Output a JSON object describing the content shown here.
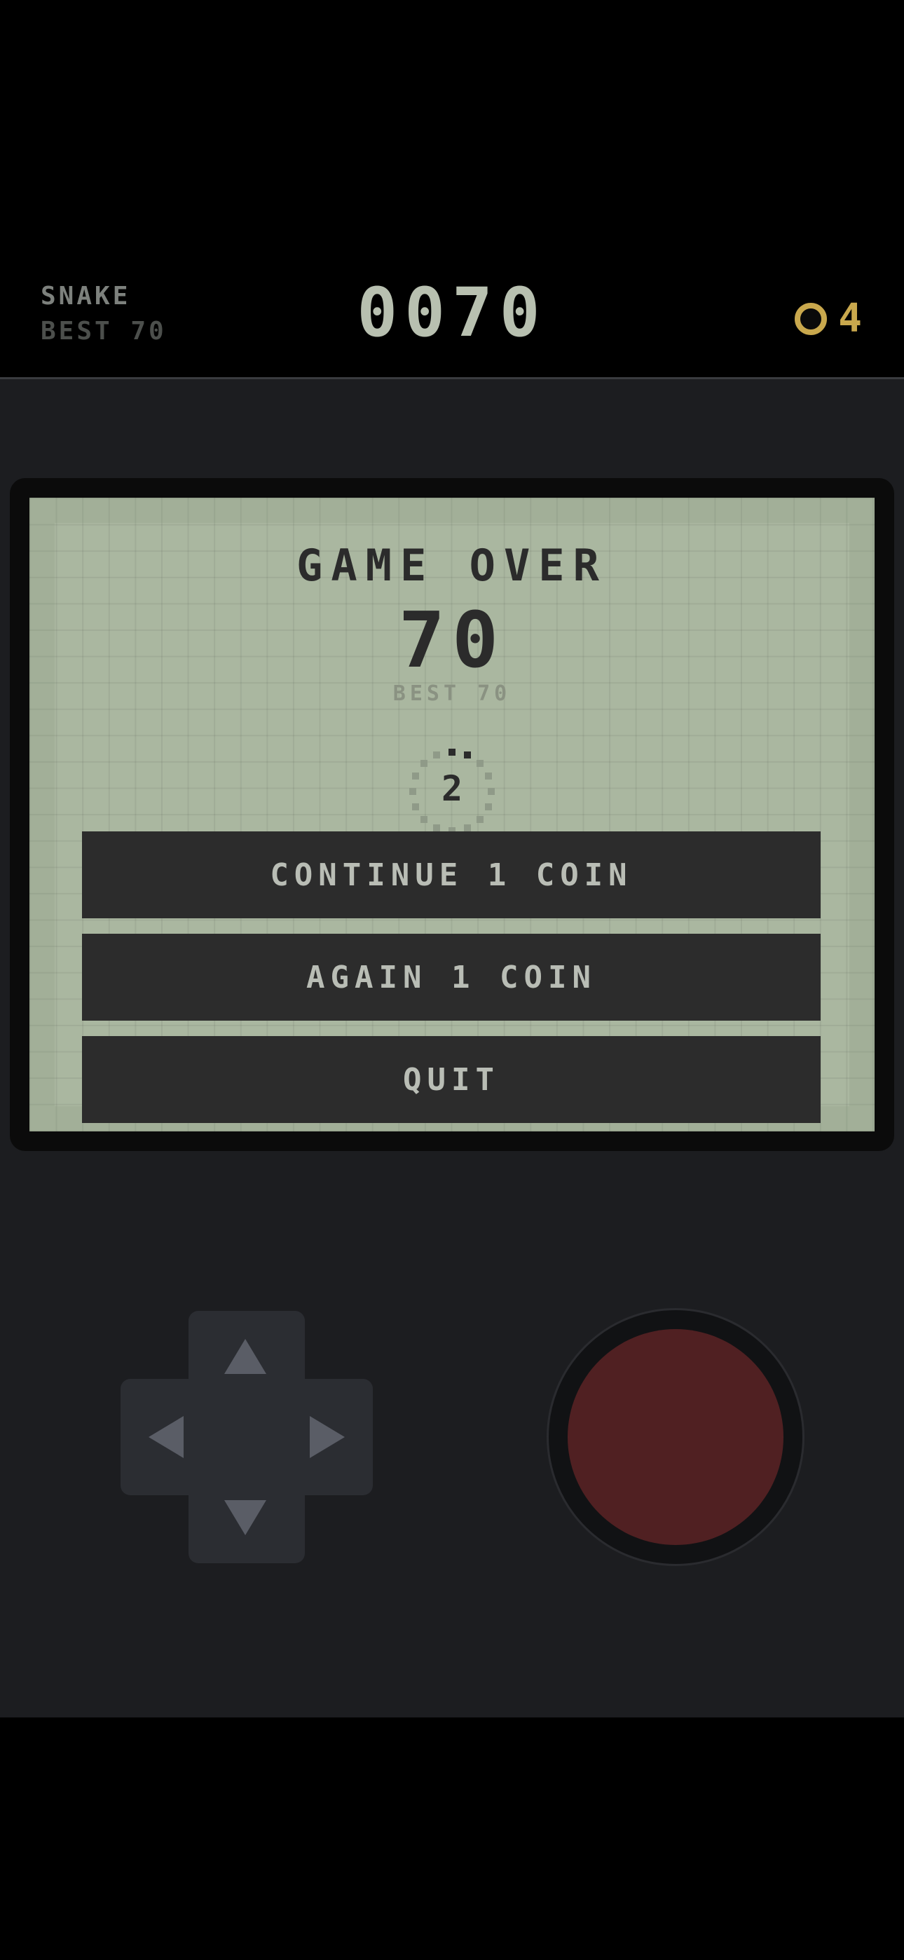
{
  "hud": {
    "game_name": "SNAKE",
    "best_label": "BEST 70",
    "score": "0070",
    "coins": "4",
    "coin_color": "#c9a84d"
  },
  "game_over": {
    "title": "GAME OVER",
    "score": "70",
    "best_label": "BEST 70",
    "countdown": "2"
  },
  "buttons": {
    "continue_label": "CONTINUE 1 COIN",
    "again_label": "AGAIN 1 COIN",
    "quit_label": "QUIT"
  },
  "colors": {
    "lcd_background": "#aab7a0",
    "pixel_dark": "#2b2b2b",
    "button_bg": "#2c2c2c",
    "console_bg": "#1c1d20",
    "action_button": "#502022"
  },
  "controls": {
    "dpad_icons": [
      "arrow-up-icon",
      "arrow-down-icon",
      "arrow-left-icon",
      "arrow-right-icon"
    ],
    "action_icon": "action-button"
  }
}
